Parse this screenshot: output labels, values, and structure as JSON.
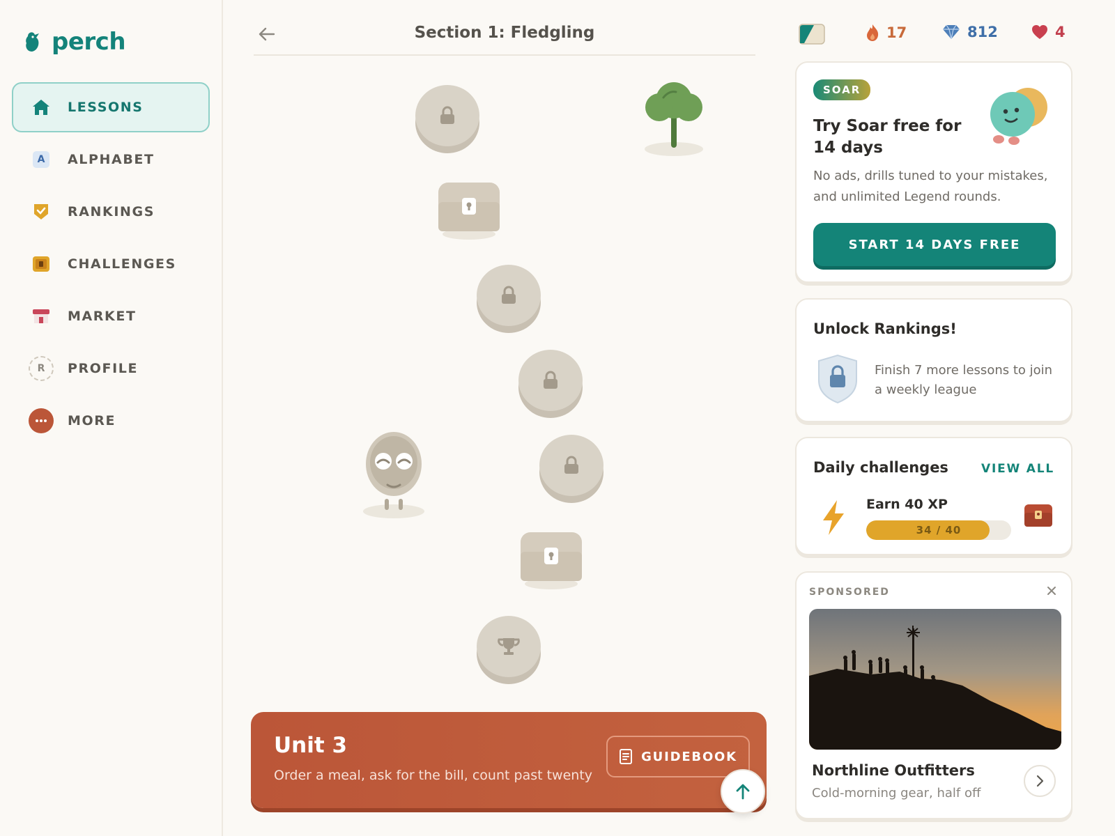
{
  "app": {
    "name": "perch",
    "brand_color": "#14837a",
    "accent_orange": "#bb5638"
  },
  "sidebar": {
    "items": [
      {
        "label": "LESSONS",
        "icon": "home-icon",
        "active": true
      },
      {
        "label": "ALPHABET",
        "icon": "alphabet-icon",
        "icon_letter": "A"
      },
      {
        "label": "RANKINGS",
        "icon": "rankings-shield-icon"
      },
      {
        "label": "CHALLENGES",
        "icon": "challenges-chest-icon"
      },
      {
        "label": "MARKET",
        "icon": "market-shop-icon"
      },
      {
        "label": "PROFILE",
        "icon": "profile-avatar-icon",
        "icon_letter": "R"
      },
      {
        "label": "MORE",
        "icon": "more-dots-icon"
      }
    ]
  },
  "header": {
    "section_title": "Section 1: Fledgling"
  },
  "stats": {
    "streak": "17",
    "gems": "812",
    "hearts": "4",
    "course_flag": "course-flag-icon"
  },
  "path": {
    "nodes": [
      {
        "type": "lesson",
        "state": "locked",
        "icon": "lock-icon"
      },
      {
        "type": "chest",
        "state": "locked",
        "icon": "chest-icon"
      },
      {
        "type": "lesson",
        "state": "locked",
        "icon": "lock-icon"
      },
      {
        "type": "lesson",
        "state": "locked",
        "icon": "lock-icon"
      },
      {
        "type": "lesson",
        "state": "locked",
        "icon": "lock-icon"
      },
      {
        "type": "chest",
        "state": "locked",
        "icon": "chest-icon"
      },
      {
        "type": "trophy",
        "state": "locked",
        "icon": "trophy-icon"
      }
    ],
    "decorations": [
      "tree-icon",
      "sleeping-character-icon"
    ]
  },
  "unit": {
    "title": "Unit 3",
    "subtitle": "Order a meal, ask for the bill, count past twenty",
    "guidebook_label": "GUIDEBOOK"
  },
  "soar": {
    "badge": "SOAR",
    "title": "Try Soar free for 14 days",
    "description": "No ads, drills tuned to your mistakes, and unlimited Legend rounds.",
    "cta": "START 14 DAYS FREE"
  },
  "rankings": {
    "title": "Unlock Rankings!",
    "description": "Finish 7 more lessons to join a weekly league"
  },
  "daily": {
    "title": "Daily challenges",
    "view_all": "VIEW ALL",
    "challenge": {
      "name": "Earn 40 XP",
      "progress_text": "34 / 40",
      "progress": 0.85
    }
  },
  "ad": {
    "label": "SPONSORED",
    "brand": "Northline Outfitters",
    "tagline": "Cold-morning gear, half off"
  }
}
